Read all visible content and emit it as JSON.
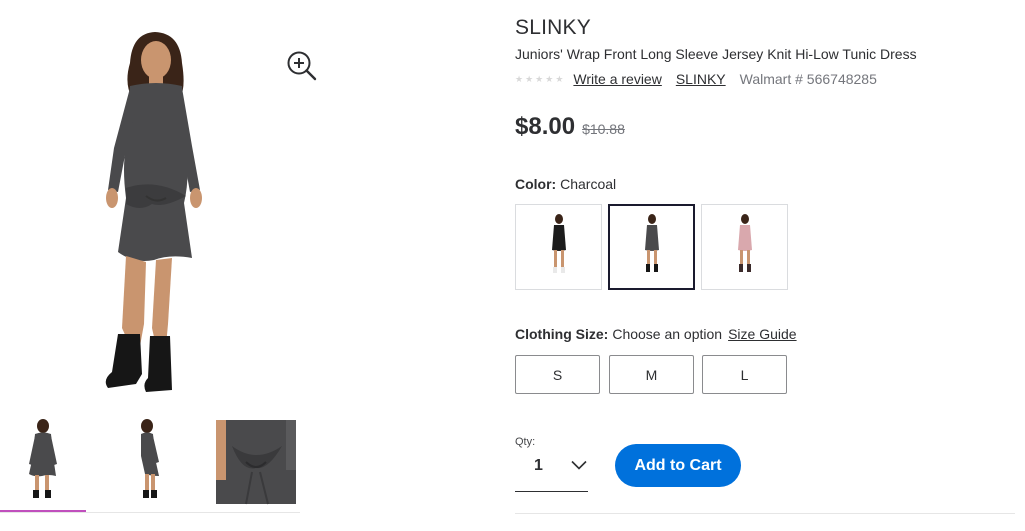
{
  "product": {
    "brand": "SLINKY",
    "title": "Juniors' Wrap Front Long Sleeve Jersey Knit Hi-Low Tunic Dress",
    "review_link": "Write a review",
    "brand_link": "SLINKY",
    "walmart_number": "Walmart # 566748285",
    "rating": 0,
    "rating_max": 5
  },
  "pricing": {
    "price": "$8.00",
    "was_price": "$10.88"
  },
  "color": {
    "label": "Color:",
    "selected": "Charcoal",
    "swatches": [
      "black",
      "charcoal",
      "pink"
    ]
  },
  "size": {
    "label": "Clothing Size:",
    "prompt": "Choose an option",
    "guide_link": "Size Guide",
    "options": [
      "S",
      "M",
      "L"
    ]
  },
  "quantity": {
    "label": "Qty:",
    "value": "1"
  },
  "cart": {
    "button_label": "Add to Cart"
  },
  "gallery": {
    "zoom_icon": "zoom-in-icon",
    "selected_thumbnail": 1,
    "thumbnail_count": 3
  },
  "colors": {
    "primary_button": "#0071dc",
    "thumbnail_highlight": "#c04fbd",
    "charcoal": "#4a4a4c",
    "black": "#1c1c1c",
    "pink": "#d9a8ad"
  }
}
